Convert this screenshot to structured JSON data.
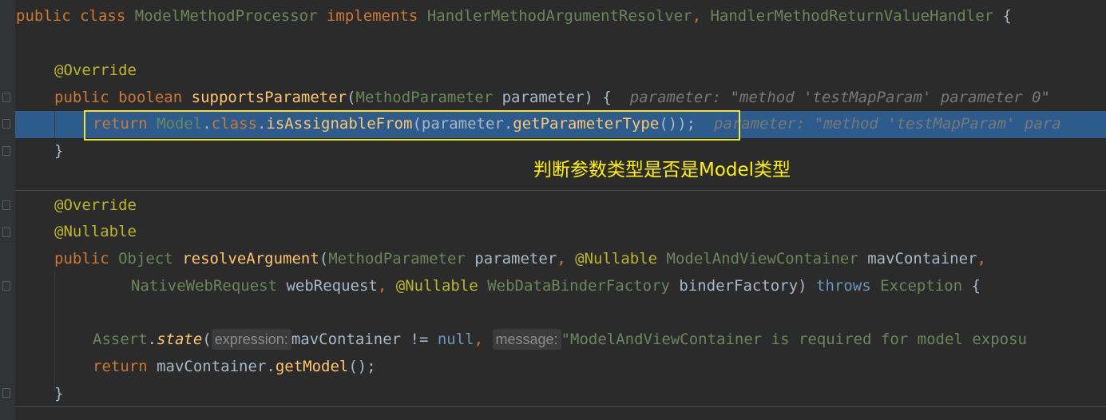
{
  "editor": {
    "line1": {
      "kw_public": "public",
      "kw_class": "class",
      "class_name": "ModelMethodProcessor",
      "kw_implements": "implements",
      "iface1": "HandlerMethodArgumentResolver",
      "comma": ",",
      "iface2": "HandlerMethodReturnValueHandler",
      "brace": "{"
    },
    "line3": {
      "annotation": "@Override"
    },
    "line4": {
      "kw_public": "public",
      "kw_boolean": "boolean",
      "method": "supportsParameter",
      "open": "(",
      "param_type": "MethodParameter",
      "param_name": "parameter",
      "close": ") {",
      "inlay": "parameter: \"method 'testMapParam' parameter 0\""
    },
    "line5": {
      "kw_return": "return",
      "model": "Model",
      "dot1": ".",
      "kw_class": "class",
      "dot2": ".",
      "method": "isAssignableFrom",
      "args": "(parameter.",
      "getter": "getParameterType",
      "tail": "());",
      "inlay": "parameter: \"method 'testMapParam' para"
    },
    "line6": {
      "brace": "}"
    },
    "line8": {
      "annotation": "@Override"
    },
    "line9": {
      "annotation": "@Nullable"
    },
    "line10": {
      "kw_public": "public",
      "type_object": "Object",
      "method": "resolveArgument",
      "open": "(",
      "p1_type": "MethodParameter",
      "p1_name": "parameter",
      "comma1": ",",
      "ann": "@Nullable",
      "p2_type": "ModelAndViewContainer",
      "p2_name": "mavContainer",
      "comma2": ","
    },
    "line11": {
      "p3_type": "NativeWebRequest",
      "p3_name": "webRequest",
      "comma": ",",
      "ann": "@Nullable",
      "p4_type": "WebDataBinderFactory",
      "p4_name": "binderFactory",
      "close": ")",
      "kw_throws": "throws",
      "exc": "Exception",
      "brace": "{"
    },
    "line13": {
      "cls": "Assert",
      "dot": ".",
      "method": "state",
      "open": "(",
      "hint1": "expression:",
      "expr": "mavContainer != ",
      "kw_null": "null",
      "comma": ",",
      "hint2": "message:",
      "str": "\"ModelAndViewContainer is required for model exposu"
    },
    "line14": {
      "kw_return": "return",
      "obj": "mavContainer.",
      "method": "getModel",
      "tail": "();"
    },
    "line15": {
      "brace": "}"
    }
  },
  "annotation_note": "判断参数类型是否是Model类型",
  "colors": {
    "background": "#2b2b2b",
    "keyword": "#cc7832",
    "annotation": "#bbb529",
    "highlight_row": "#2d5c8c",
    "highlight_box": "#f3e230",
    "note_text": "#fff200"
  }
}
